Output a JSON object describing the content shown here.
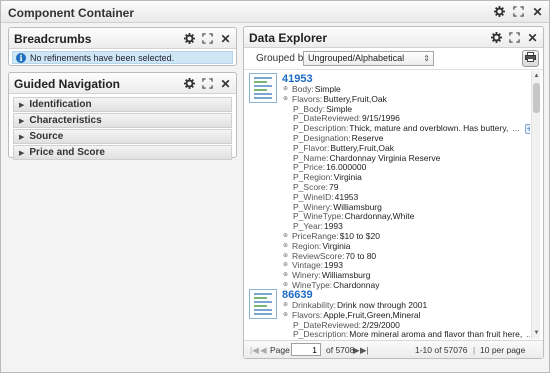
{
  "container": {
    "title": "Component Container"
  },
  "breadcrumbs": {
    "title": "Breadcrumbs",
    "message": "No refinements have been selected."
  },
  "guided_nav": {
    "title": "Guided Navigation",
    "items": [
      {
        "label": "Identification"
      },
      {
        "label": "Characteristics"
      },
      {
        "label": "Source"
      },
      {
        "label": "Price and Score"
      }
    ]
  },
  "data_explorer": {
    "title": "Data Explorer",
    "grouped_by_label": "Grouped by:",
    "grouped_by_value": "Ungrouped/Alphabetical",
    "records": [
      {
        "id": "41953",
        "lines": [
          {
            "key": "Body:",
            "value": "Simple"
          },
          {
            "key": "Flavors:",
            "value": "Buttery,Fruit,Oak"
          },
          {
            "key": "P_Body:",
            "value": "Simple"
          },
          {
            "key": "P_DateReviewed:",
            "value": "9/15/1996"
          },
          {
            "key": "P_Description:",
            "value": "Thick, mature and overblown. Has buttery,",
            "more": "..."
          },
          {
            "key": "P_Designation:",
            "value": "Reserve"
          },
          {
            "key": "P_Flavor:",
            "value": "Buttery,Fruit,Oak"
          },
          {
            "key": "P_Name:",
            "value": "Chardonnay Virginia Reserve"
          },
          {
            "key": "P_Price:",
            "value": "16.000000"
          },
          {
            "key": "P_Region:",
            "value": "Virginia"
          },
          {
            "key": "P_Score:",
            "value": "79"
          },
          {
            "key": "P_WineID:",
            "value": "41953"
          },
          {
            "key": "P_Winery:",
            "value": "Williamsburg"
          },
          {
            "key": "P_WineType:",
            "value": "Chardonnay,White"
          },
          {
            "key": "P_Year:",
            "value": "1993"
          },
          {
            "key": "PriceRange:",
            "value": "$10 to $20"
          },
          {
            "key": "Region:",
            "value": "Virginia"
          },
          {
            "key": "ReviewScore:",
            "value": "70 to 80"
          },
          {
            "key": "Vintage:",
            "value": "1993"
          },
          {
            "key": "Winery:",
            "value": "Williamsburg"
          },
          {
            "key": "WineType:",
            "value": "Chardonnay"
          }
        ]
      },
      {
        "id": "86639",
        "lines": [
          {
            "key": "Drinkability:",
            "value": "Drink now through 2001"
          },
          {
            "key": "Flavors:",
            "value": "Apple,Fruit,Green,Mineral"
          },
          {
            "key": "P_DateReviewed:",
            "value": "2/29/2000"
          },
          {
            "key": "P_Description:",
            "value": "More mineral aroma and flavor than fruit here,",
            "more": "..."
          }
        ]
      }
    ],
    "pager": {
      "page_label": "Page",
      "page_value": "1",
      "of_label": "of 5708",
      "range_label": "1-10 of 57076",
      "separator": "|",
      "per_page_label": "10 per page"
    }
  }
}
